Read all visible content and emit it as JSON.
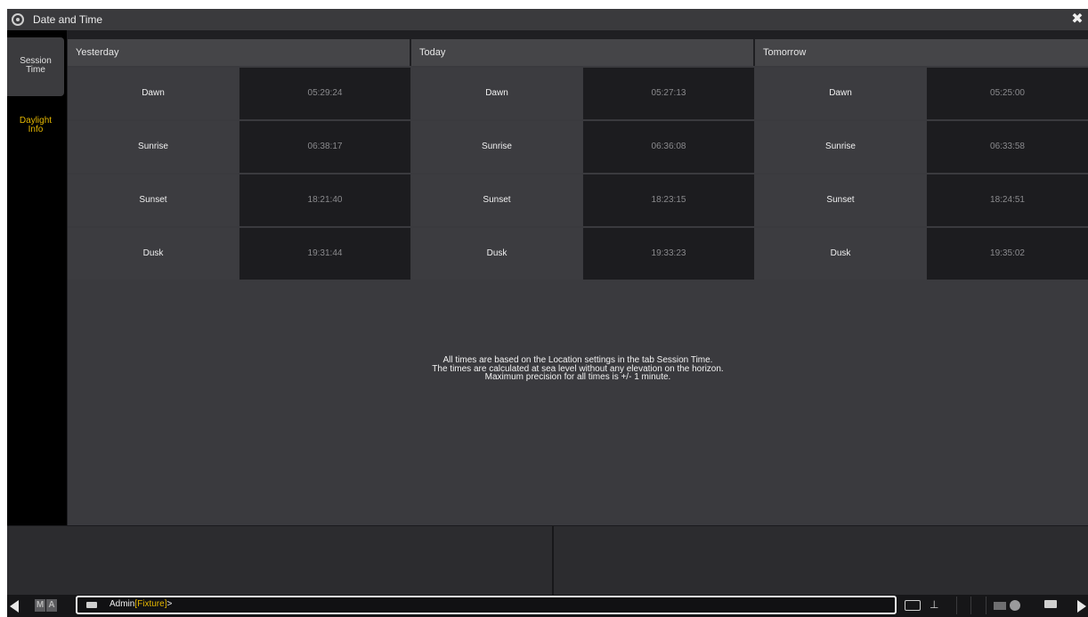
{
  "window": {
    "title": "Date and Time"
  },
  "sidebar": {
    "tabs": [
      {
        "label_line1": "Session",
        "label_line2": "Time",
        "state": "active"
      },
      {
        "label_line1": "Daylight",
        "label_line2": "Info",
        "state": "selected"
      }
    ]
  },
  "days": [
    {
      "header": "Yesterday",
      "rows": [
        {
          "label": "Dawn",
          "value": "05:29:24"
        },
        {
          "label": "Sunrise",
          "value": "06:38:17"
        },
        {
          "label": "Sunset",
          "value": "18:21:40"
        },
        {
          "label": "Dusk",
          "value": "19:31:44"
        }
      ]
    },
    {
      "header": "Today",
      "rows": [
        {
          "label": "Dawn",
          "value": "05:27:13"
        },
        {
          "label": "Sunrise",
          "value": "06:36:08"
        },
        {
          "label": "Sunset",
          "value": "18:23:15"
        },
        {
          "label": "Dusk",
          "value": "19:33:23"
        }
      ]
    },
    {
      "header": "Tomorrow",
      "rows": [
        {
          "label": "Dawn",
          "value": "05:25:00"
        },
        {
          "label": "Sunrise",
          "value": "06:33:58"
        },
        {
          "label": "Sunset",
          "value": "18:24:51"
        },
        {
          "label": "Dusk",
          "value": "19:35:02"
        }
      ]
    }
  ],
  "note": {
    "line1": "All times are based on the Location settings in the tab Session Time.",
    "line2": "The times are calculated at sea level without any elevation on the horizon.",
    "line3": "Maximum precision for all times is +/-  1 minute."
  },
  "command_line": {
    "badge_m": "M",
    "badge_a": "A",
    "user": "Admin",
    "fixture": "[Fixture]",
    "prompt": ">"
  },
  "colors": {
    "accent_yellow": "#e6b800",
    "background": "#1f1f22",
    "panel": "#3a3a3e",
    "value_cell": "#1c1c1f"
  },
  "icons": {
    "title": "clock-icon",
    "close": "close-icon",
    "nav_left": "arrow-left-icon",
    "nav_right": "arrow-right-icon",
    "keyboard": "keyboard-icon",
    "network": "network-icon",
    "globe": "globe-icon"
  }
}
